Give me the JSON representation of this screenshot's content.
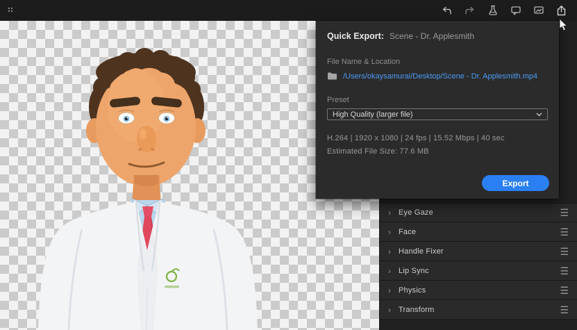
{
  "topbar": {
    "icons": [
      "app-menu",
      "undo",
      "redo",
      "lab",
      "comments",
      "scene-view",
      "share-export"
    ]
  },
  "popup": {
    "title": "Quick Export:",
    "scene_name": "Scene - Dr. Applesmith",
    "file_section_label": "File Name & Location",
    "file_path": "/Users/okaysamurai/Desktop/Scene - Dr. Applesmith.mp4",
    "preset_label": "Preset",
    "preset_value": "High Quality (larger file)",
    "info_line": "H.264 | 1920 x 1080 | 24 fps | 15.52 Mbps | 40 sec",
    "estimated_size": "Estimated File Size: 77.6 MB",
    "export_button": "Export",
    "accent_color": "#2a7ff2",
    "link_color": "#4b9cf5"
  },
  "properties_panel": {
    "rows": [
      {
        "label": "Eye Gaze"
      },
      {
        "label": "Face"
      },
      {
        "label": "Handle Fixer"
      },
      {
        "label": "Lip Sync"
      },
      {
        "label": "Physics"
      },
      {
        "label": "Transform"
      }
    ]
  }
}
